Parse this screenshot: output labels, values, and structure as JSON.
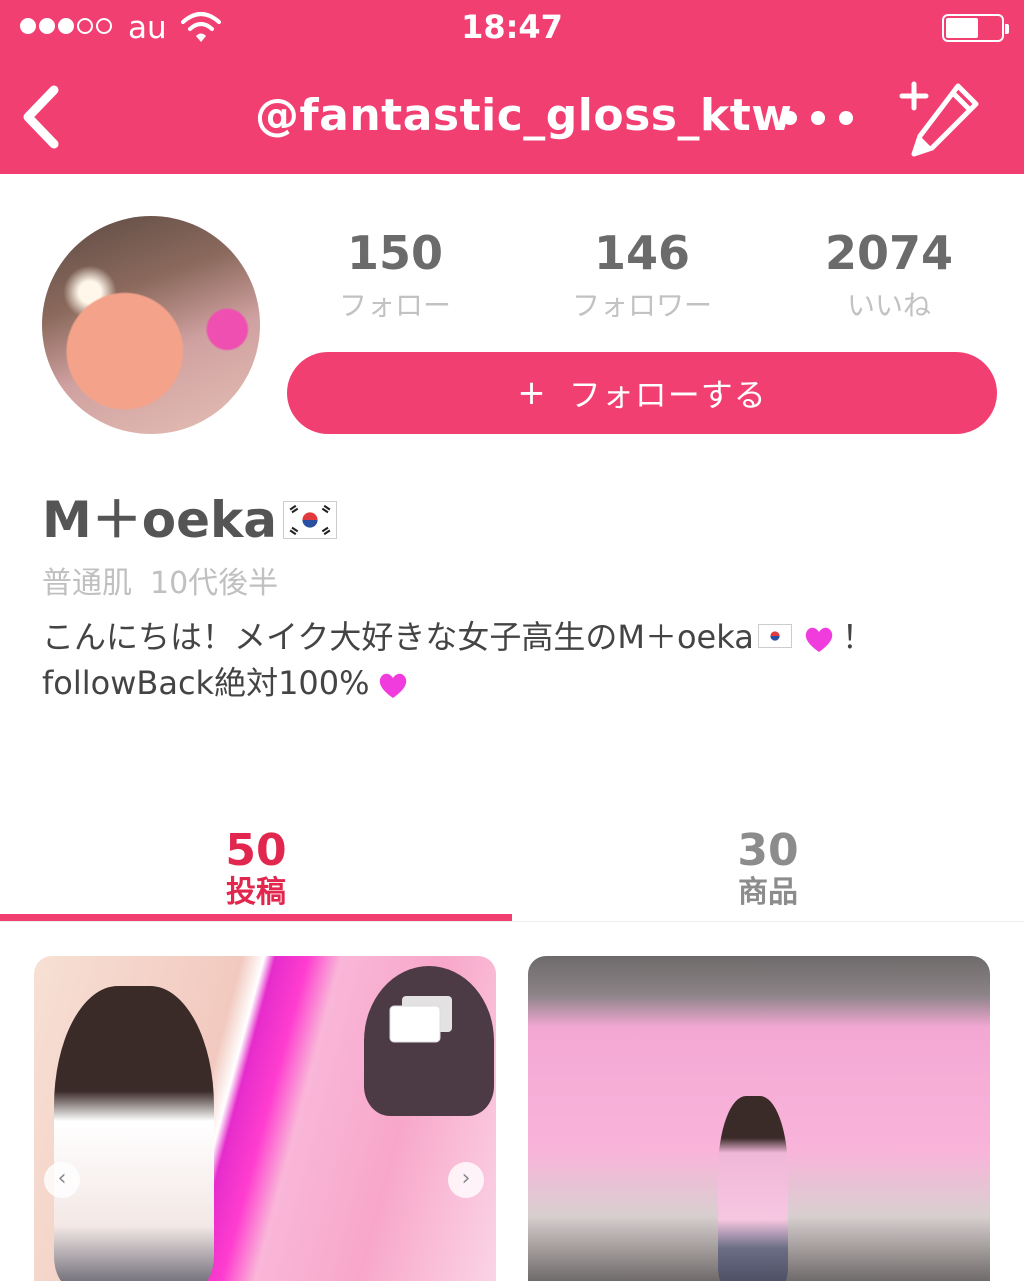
{
  "status_bar": {
    "signal_dots_filled": 3,
    "signal_dots_total": 5,
    "carrier": "au",
    "time": "18:47",
    "battery_level": 0.6
  },
  "nav": {
    "back_icon": "chevron-left-icon",
    "title": "@fantastic_gloss_ktw",
    "more_icon": "more-horizontal-icon",
    "edit_icon": "pencil-add-icon"
  },
  "profile": {
    "stats": [
      {
        "value": "150",
        "label": "フォロー"
      },
      {
        "value": "146",
        "label": "フォロワー"
      },
      {
        "value": "2074",
        "label": "いいね"
      }
    ],
    "follow_button": {
      "plus": "+",
      "label": "フォローする"
    },
    "name": "M＋oeka",
    "name_flag_icon": "korea-flag-icon",
    "attributes": [
      "普通肌",
      "10代後半"
    ],
    "bio": {
      "line1_part1": "こんにちは！メイク大好きな女子高生のM＋oeka",
      "line1_part2": "！",
      "line2_part1": "followBack絶対100%"
    }
  },
  "tabs": [
    {
      "count": "50",
      "label": "投稿",
      "active": true
    },
    {
      "count": "30",
      "label": "商品",
      "active": false
    }
  ],
  "posts": [
    {
      "multi_image": true,
      "has_arrows": true
    },
    {
      "multi_image": false,
      "has_arrows": false
    }
  ],
  "colors": {
    "brand_pink": "#f23f72",
    "active_tab": "#e2274f",
    "heart": "#f03cdc"
  }
}
